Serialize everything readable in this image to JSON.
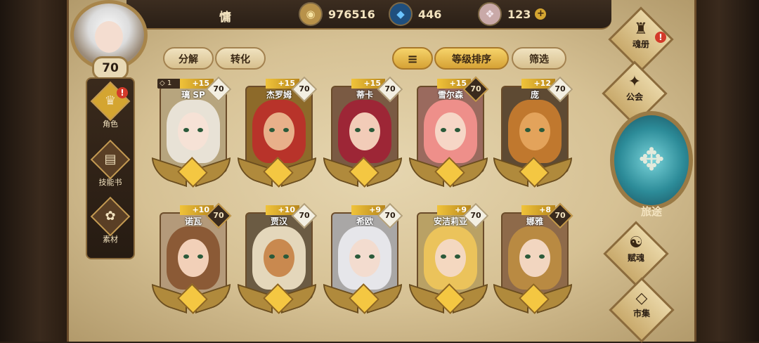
{
  "player": {
    "name": "慵",
    "level": "70"
  },
  "currencies": [
    {
      "icon": "gold-coin-icon",
      "glyph": "◉",
      "value": "976516",
      "color": "#b8924a"
    },
    {
      "icon": "blue-crystal-icon",
      "glyph": "◆",
      "value": "446",
      "color": "#2e7fc1"
    },
    {
      "icon": "pink-gem-icon",
      "glyph": "❖",
      "value": "123",
      "color": "#d8b6c0",
      "plus": "+"
    }
  ],
  "left_nav": [
    {
      "label": "角色",
      "glyph": "♛",
      "active": true,
      "alert": "!"
    },
    {
      "label": "技能书",
      "glyph": "▤",
      "active": false
    },
    {
      "label": "素材",
      "glyph": "✿",
      "active": false
    }
  ],
  "toolbar": {
    "decompose": "分解",
    "convert": "转化",
    "sort_icon": "≡",
    "sort_level": "等级排序",
    "filter": "筛选"
  },
  "heroes": [
    {
      "name": "璃 SP",
      "plus": "+15",
      "level": "70",
      "gem": "◇ 1",
      "hair": "#e8e2d6",
      "skin": "#f6e2d6",
      "bg": "#b7a57e",
      "dark": false
    },
    {
      "name": "杰罗姆",
      "plus": "+15",
      "level": "70",
      "hair": "#b8332a",
      "skin": "#e8b08a",
      "bg": "#8d6a2a",
      "dark": false
    },
    {
      "name": "蒂卡",
      "plus": "+15",
      "level": "70",
      "hair": "#9d2636",
      "skin": "#f2ccb8",
      "bg": "#7a5a43",
      "dark": false
    },
    {
      "name": "雪尔森",
      "plus": "+15",
      "level": "70",
      "hair": "#ee8f8a",
      "skin": "#f6d6c6",
      "bg": "#9a6a5e",
      "dark": true
    },
    {
      "name": "庞",
      "plus": "+12",
      "level": "70",
      "hair": "#c0782e",
      "skin": "#e3a35b",
      "bg": "#5e4a33",
      "dark": false
    },
    {
      "name": "诺瓦",
      "plus": "+10",
      "level": "70",
      "hair": "#8b5a36",
      "skin": "#f2d0b8",
      "bg": "#b49a7a",
      "dark": true
    },
    {
      "name": "贾汉",
      "plus": "+10",
      "level": "70",
      "hair": "#e4d7bb",
      "skin": "#c9894f",
      "bg": "#6b5b43",
      "dark": false
    },
    {
      "name": "希欧",
      "plus": "+9",
      "level": "70",
      "hair": "#e6e6ea",
      "skin": "#f3dccf",
      "bg": "#a9a7a6",
      "dark": false
    },
    {
      "name": "安洁莉亚",
      "plus": "+9",
      "level": "70",
      "hair": "#ebc35b",
      "skin": "#f4d8c0",
      "bg": "#b9a165",
      "dark": false
    },
    {
      "name": "娜雅",
      "plus": "+8",
      "level": "70",
      "hair": "#b98a42",
      "skin": "#f2d6c0",
      "bg": "#8e6a4a",
      "dark": true
    }
  ],
  "right_nav": {
    "soul_book": {
      "label": "魂册",
      "glyph": "♜",
      "alert": "!"
    },
    "guild": {
      "label": "公会",
      "glyph": "✦"
    },
    "journey": {
      "label": "旅途",
      "glyph": "✥"
    },
    "talent": {
      "label": "赋魂",
      "glyph": "☯"
    },
    "market": {
      "label": "市集",
      "glyph": "◇"
    }
  }
}
